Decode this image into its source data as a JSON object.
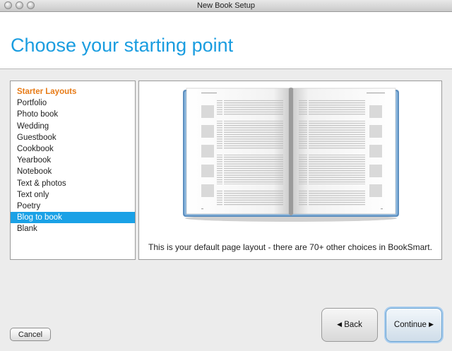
{
  "window": {
    "title": "New Book Setup"
  },
  "header": {
    "title": "Choose your starting point"
  },
  "sidebar": {
    "items": [
      {
        "label": "Starter Layouts",
        "type": "heading"
      },
      {
        "label": "Portfolio"
      },
      {
        "label": "Photo book"
      },
      {
        "label": "Wedding"
      },
      {
        "label": "Guestbook"
      },
      {
        "label": "Cookbook"
      },
      {
        "label": "Yearbook"
      },
      {
        "label": "Notebook"
      },
      {
        "label": "Text & photos"
      },
      {
        "label": "Text only"
      },
      {
        "label": "Poetry"
      },
      {
        "label": "Blog to book",
        "selected": true
      },
      {
        "label": "Blank"
      }
    ]
  },
  "preview": {
    "caption": "This is your default page layout - there are 70+ other choices in BookSmart."
  },
  "buttons": {
    "cancel": "Cancel",
    "back": "Back",
    "continue": "Continue"
  },
  "icons": {
    "back": "left-triangle-icon",
    "continue": "right-triangle-icon"
  },
  "colors": {
    "title": "#1a9de0",
    "heading": "#e77b17",
    "selection": "#1aa1e6"
  }
}
